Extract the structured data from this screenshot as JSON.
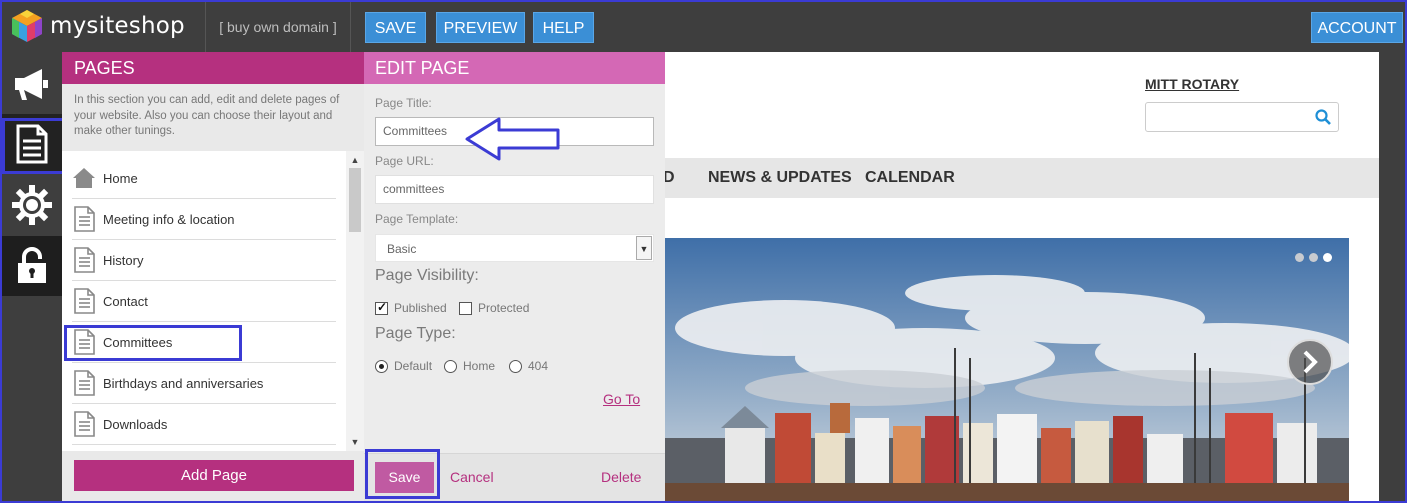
{
  "topbar": {
    "brand": "mysiteshop",
    "domain_link": "[ buy own domain ]",
    "save": "SAVE",
    "preview": "PREVIEW",
    "help": "HELP",
    "account": "ACCOUNT"
  },
  "rail": {
    "icons": [
      "megaphone-icon",
      "page-icon",
      "gear-icon",
      "lock-icon"
    ]
  },
  "pages_panel": {
    "title": "PAGES",
    "description": "In this section you can add, edit and delete pages of your website. Also you can choose their layout and make other tunings.",
    "items": [
      {
        "label": "Home",
        "icon": "home-icon"
      },
      {
        "label": "Meeting info & location",
        "icon": "page-icon"
      },
      {
        "label": "History",
        "icon": "page-icon"
      },
      {
        "label": "Contact",
        "icon": "page-icon"
      },
      {
        "label": "Committees",
        "icon": "page-icon"
      },
      {
        "label": "Birthdays and anniversaries",
        "icon": "page-icon"
      },
      {
        "label": "Downloads",
        "icon": "page-icon"
      }
    ],
    "add_button": "Add Page"
  },
  "edit_panel": {
    "title": "EDIT PAGE",
    "page_title_label": "Page Title:",
    "page_title_value": "Committees",
    "page_url_label": "Page URL:",
    "page_url_value": "committees",
    "template_label": "Page Template:",
    "template_value": "Basic",
    "visibility_label": "Page Visibility:",
    "visibility_options": [
      {
        "label": "Published",
        "checked": true
      },
      {
        "label": "Protected",
        "checked": false
      }
    ],
    "type_label": "Page Type:",
    "type_options": [
      {
        "label": "Default",
        "checked": true
      },
      {
        "label": "Home",
        "checked": false
      },
      {
        "label": "404",
        "checked": false
      }
    ],
    "goto": "Go To",
    "save": "Save",
    "cancel": "Cancel",
    "delete": "Delete"
  },
  "site": {
    "title": "MITT ROTARY",
    "nav": [
      "D",
      "NEWS & UPDATES",
      "CALENDAR"
    ],
    "slider_dots": 3,
    "slider_active_dot": 3
  },
  "colors": {
    "accent_magenta": "#b5307f",
    "edit_pink": "#d468b5",
    "top_blue": "#3b8fd6",
    "highlight_blue": "#3b3bd4"
  }
}
